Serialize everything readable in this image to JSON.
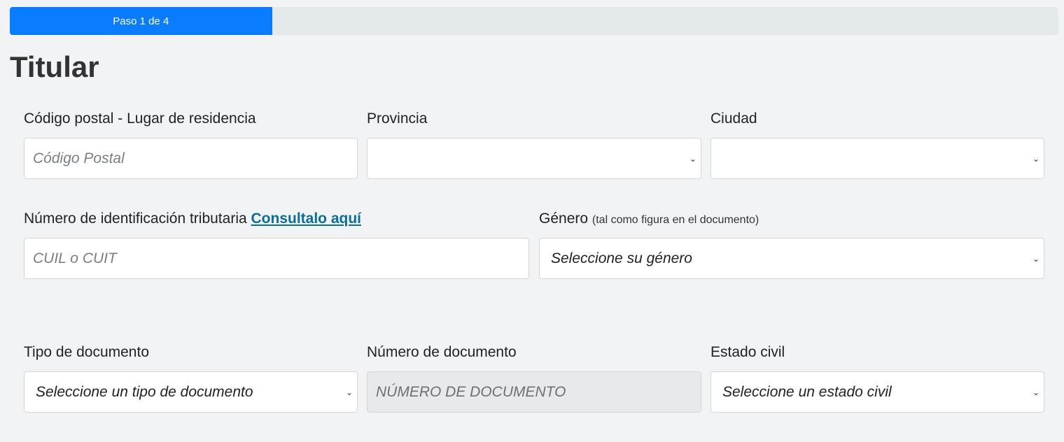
{
  "progress": {
    "label": "Paso 1 de 4",
    "fraction": 0.25,
    "color": "#0a7cff"
  },
  "title": "Titular",
  "row1": {
    "postal": {
      "label": "Código postal - Lugar de residencia",
      "placeholder": "Código Postal"
    },
    "province": {
      "label": "Provincia",
      "value": ""
    },
    "city": {
      "label": "Ciudad",
      "value": ""
    }
  },
  "row2": {
    "tax": {
      "label": "Número de identificación tributaria",
      "link": "Consultalo aquí",
      "placeholder": "CUIL o CUIT"
    },
    "gender": {
      "label": "Género",
      "hint": "(tal como figura en el documento)",
      "value": "Seleccione su género"
    }
  },
  "row3": {
    "doctype": {
      "label": "Tipo de documento",
      "value": "Seleccione un tipo de documento"
    },
    "docnumber": {
      "label": "Número de documento",
      "placeholder": "NÚMERO DE DOCUMENTO"
    },
    "civil": {
      "label": "Estado civil",
      "value": "Seleccione un estado civil"
    }
  },
  "icons": {
    "select_chevron": "chevron-down-icon"
  }
}
